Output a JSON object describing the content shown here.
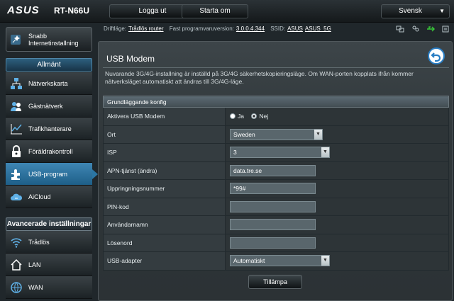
{
  "header": {
    "brand": "ASUS",
    "model": "RT-N66U",
    "logout_label": "Logga ut",
    "restart_label": "Starta om",
    "language": "Svensk"
  },
  "infobar": {
    "mode_label": "Driftläge:",
    "mode_value": "Trådlös router",
    "firmware_label": "Fast programvaruversion:",
    "firmware_value": "3.0.0.4.344",
    "ssid_label": "SSID:",
    "ssid_value_1": "ASUS",
    "ssid_value_2": "ASUS_5G"
  },
  "sidebar": {
    "quick_setup": "Snabb Internetinstallning",
    "general_title": "Allmänt",
    "general_items": [
      {
        "label": "Nätverkskarta",
        "icon": "network-map-icon"
      },
      {
        "label": "Gästnätverk",
        "icon": "guest-network-icon"
      },
      {
        "label": "Trafikhanterare",
        "icon": "traffic-manager-icon"
      },
      {
        "label": "Föräldrakontroll",
        "icon": "parental-control-icon"
      },
      {
        "label": "USB-program",
        "icon": "usb-app-icon"
      },
      {
        "label": "AiCloud",
        "icon": "aicloud-icon"
      }
    ],
    "advanced_title": "Avancerade inställningar",
    "advanced_items": [
      {
        "label": "Trådlös",
        "icon": "wireless-icon"
      },
      {
        "label": "LAN",
        "icon": "lan-icon"
      },
      {
        "label": "WAN",
        "icon": "wan-icon"
      }
    ],
    "active_index": 4
  },
  "main": {
    "title": "USB Modem",
    "description": "Nuvarande 3G/4G-installning är inställd på 3G/4G säkerhetskopieringsläge. Om WAN-porten kopplats ifrån kommer nätverksläget automatiskt att ändras till 3G/4G-läge.",
    "table_header": "Grundläggande konfig",
    "rows": {
      "enable_label": "Aktivera USB Modem",
      "enable_yes": "Ja",
      "enable_no": "Nej",
      "location_label": "Ort",
      "location_value": "Sweden",
      "isp_label": "ISP",
      "isp_value": "3",
      "apn_label": "APN-tjänst (ändra)",
      "apn_value": "data.tre.se",
      "dial_label": "Uppringningsnummer",
      "dial_value": "*99#",
      "pin_label": "PIN-kod",
      "pin_value": "",
      "username_label": "Användarnamn",
      "username_value": "",
      "password_label": "Lösenord",
      "password_value": "",
      "adapter_label": "USB-adapter",
      "adapter_value": "Automatiskt"
    },
    "apply_label": "Tillämpa"
  },
  "colors": {
    "accent": "#2b76a4",
    "panel_bg": "#2f3639"
  }
}
